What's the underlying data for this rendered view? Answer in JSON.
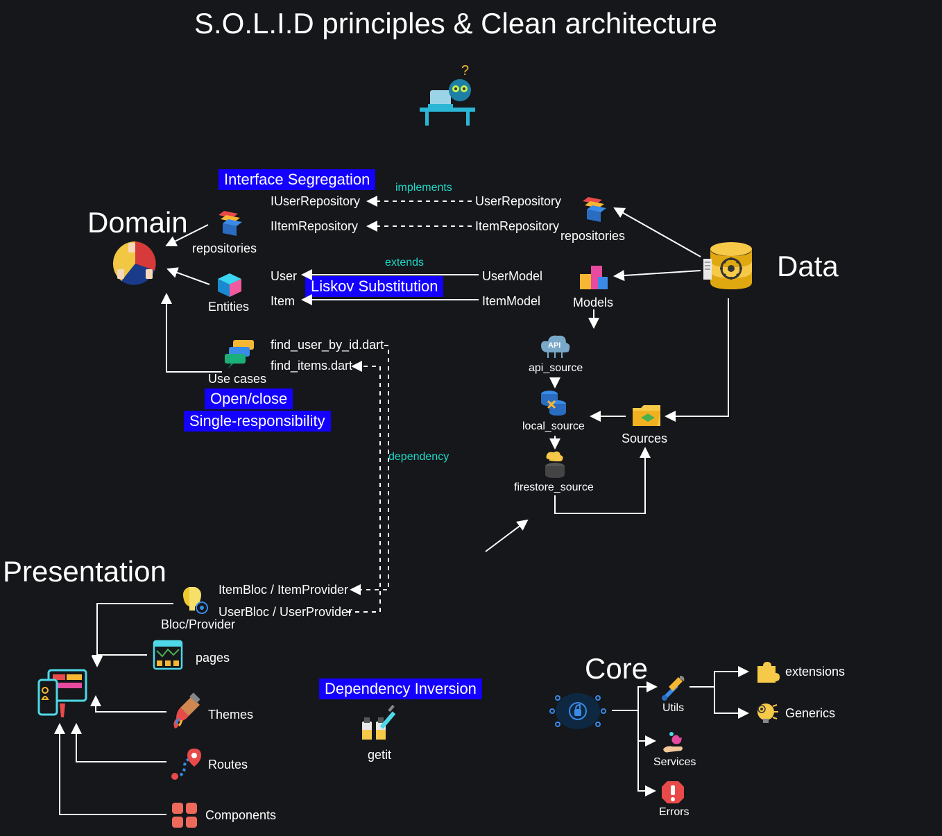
{
  "title": "S.O.L.I.D principles & Clean architecture",
  "sections": {
    "domain": "Domain",
    "data": "Data",
    "presentation": "Presentation",
    "core": "Core"
  },
  "domain": {
    "repositories_label": "repositories",
    "entities_label": "Entities",
    "usecases_label": "Use cases",
    "iuser_repo": "IUserRepository",
    "iitem_repo": "IItemRepository",
    "user": "User",
    "item": "Item",
    "find_user": "find_user_by_id.dart",
    "find_items": "find_items.dart"
  },
  "data": {
    "repositories_label": "repositories",
    "models_label": "Models",
    "sources_label": "Sources",
    "user_repo": "UserRepository",
    "item_repo": "ItemRepository",
    "user_model": "UserModel",
    "item_model": "ItemModel",
    "api_source": "api_source",
    "local_source": "local_source",
    "firestore_source": "firestore_source"
  },
  "presentation": {
    "bloc_label": "Bloc/Provider",
    "pages_label": "pages",
    "themes_label": "Themes",
    "routes_label": "Routes",
    "components_label": "Components",
    "item_bloc": "ItemBloc / ItemProvider",
    "user_bloc": "UserBloc / UserProvider"
  },
  "core": {
    "utils_label": "Utils",
    "services_label": "Services",
    "errors_label": "Errors",
    "extensions_label": "extensions",
    "generics_label": "Generics"
  },
  "solid": {
    "interface_segregation": "Interface Segregation",
    "liskov": "Liskov Substitution",
    "open_close": "Open/close",
    "single_responsibility": "Single-responsibility",
    "dependency_inversion": "Dependency Inversion"
  },
  "relations": {
    "implements": "implements",
    "extends": "extends",
    "dependency": "dependency"
  },
  "di": {
    "getit": "getit"
  }
}
